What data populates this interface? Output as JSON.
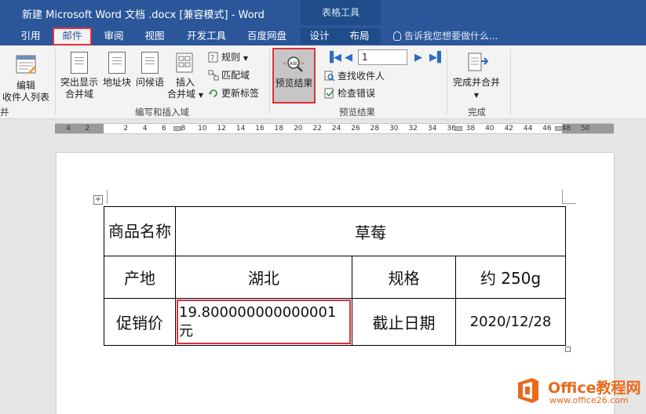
{
  "window": {
    "title": "新建 Microsoft Word 文档 .docx [兼容模式] - Word",
    "context_label": "表格工具"
  },
  "tabs": [
    {
      "label": "引用"
    },
    {
      "label": "邮件",
      "active": true
    },
    {
      "label": "审阅"
    },
    {
      "label": "视图"
    },
    {
      "label": "开发工具"
    },
    {
      "label": "百度网盘"
    },
    {
      "label": "设计"
    },
    {
      "label": "布局"
    }
  ],
  "tell_me": "告诉我您想要做什么...",
  "ribbon": {
    "start_group": {
      "edit_recipients": [
        "编辑",
        "收件人列表"
      ],
      "label_fragment": "并"
    },
    "write_insert": {
      "highlight_fields": [
        "突出显示",
        "合并域"
      ],
      "address_block": "地址块",
      "greeting_line": "问候语",
      "insert_field": [
        "插入",
        "合并域"
      ],
      "rules": "规则",
      "match_fields": "匹配域",
      "update_labels": "更新标签",
      "label": "编写和插入域"
    },
    "preview": {
      "preview_results": "预览结果",
      "record_number": "1",
      "find_recipient": "查找收件人",
      "check_errors": "检查错误",
      "label": "预览结果"
    },
    "finish": {
      "finish_merge": "完成并合并",
      "label": "完成"
    }
  },
  "ruler": {
    "numbers": [
      "4",
      "2",
      "",
      "2",
      "4",
      "6",
      "8",
      "10",
      "12",
      "14",
      "16",
      "18",
      "20",
      "22",
      "24",
      "26",
      "28",
      "30",
      "32",
      "34",
      "36",
      "38",
      "40",
      "42",
      "44",
      "46",
      "48",
      "50"
    ]
  },
  "table": {
    "row1": {
      "label": "商品名称",
      "value": "草莓"
    },
    "row2": {
      "label_a": "产地",
      "value_a": "湖北",
      "label_b": "规格",
      "value_b": "约 250g"
    },
    "row3": {
      "label_a": "促销价",
      "value_a": "19.800000000000001元",
      "label_b": "截止日期",
      "value_b": "2020/12/28"
    }
  },
  "watermark": {
    "brand": "Office教程网",
    "url": "www.office26.com"
  },
  "colors": {
    "word_blue": "#2b579a",
    "highlight_red": "#e0303a",
    "watermark_orange": "#e86a1c"
  }
}
